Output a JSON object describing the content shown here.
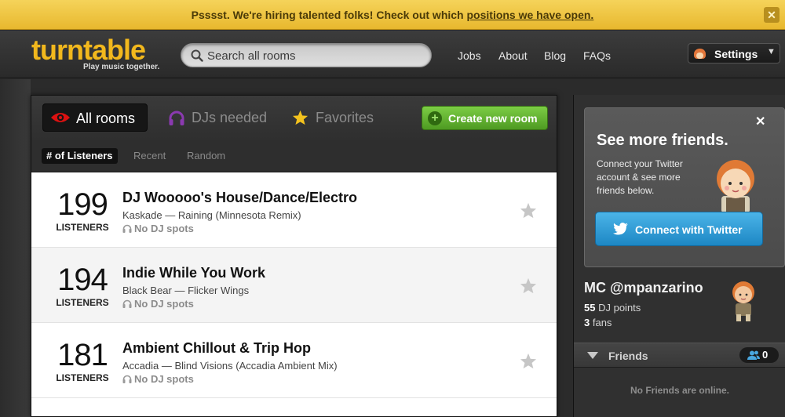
{
  "banner": {
    "text": "Psssst. We're hiring talented folks! Check out which",
    "link": "positions we have open.",
    "close_label": "✕"
  },
  "header": {
    "logo": "turntable",
    "tagline": "Play music together.",
    "search_placeholder": "Search all rooms",
    "nav": [
      "Jobs",
      "About",
      "Blog",
      "FAQs"
    ],
    "settings_label": "Settings"
  },
  "tabs": {
    "all_rooms": "All rooms",
    "djs_needed": "DJs needed",
    "favorites": "Favorites",
    "create_room": "Create new room"
  },
  "sorts": [
    "# of Listeners",
    "Recent",
    "Random"
  ],
  "rooms": [
    {
      "count": "199",
      "listeners_label": "LISTENERS",
      "name": "DJ Wooooo's House/Dance/Electro",
      "song": "Kaskade — Raining (Minnesota Remix)",
      "dj_status": "No DJ spots"
    },
    {
      "count": "194",
      "listeners_label": "LISTENERS",
      "name": "Indie While You Work",
      "song": "Black Bear — Flicker Wings",
      "dj_status": "No DJ spots"
    },
    {
      "count": "181",
      "listeners_label": "LISTENERS",
      "name": "Ambient Chillout & Trip Hop",
      "song": "Accadia — Blind Visions (Accadia Ambient Mix)",
      "dj_status": "No DJ spots"
    }
  ],
  "sidebar": {
    "promo": {
      "title": "See more friends.",
      "text": "Connect your Twitter account & see more friends below.",
      "button": "Connect with Twitter",
      "close_label": "✕"
    },
    "user": {
      "name": "MC @mpanzarino",
      "dj_points_value": "55",
      "dj_points_label": "DJ points",
      "fans_value": "3",
      "fans_label": "fans"
    },
    "friends": {
      "label": "Friends",
      "count": "0",
      "empty_text": "No Friends are online."
    }
  },
  "colors": {
    "brand": "#f2b81d",
    "banner": "#f0c646",
    "create_green": "#5aab2c",
    "twitter_blue": "#2a9ad8"
  }
}
